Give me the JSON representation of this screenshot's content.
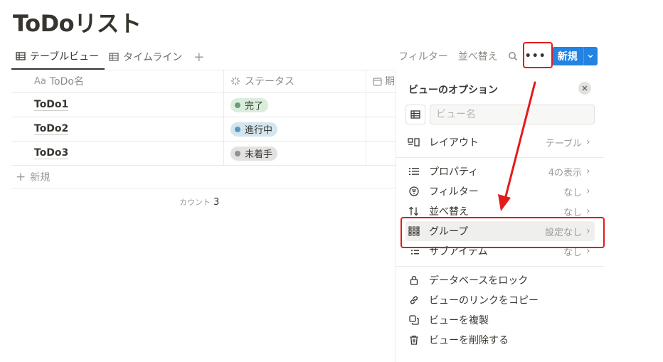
{
  "page": {
    "title": "ToDoリスト"
  },
  "views": {
    "tabs": [
      {
        "label": "テーブルビュー",
        "icon": "table-icon",
        "active": true
      },
      {
        "label": "タイムライン",
        "icon": "timeline-icon",
        "active": false
      }
    ],
    "add_symbol": "+"
  },
  "toolbar": {
    "filter": "フィルター",
    "sort": "並べ替え",
    "search_icon": "search-icon",
    "more": "•••",
    "new_label": "新規"
  },
  "table": {
    "columns": [
      {
        "prefix": "Aa",
        "label": "ToDo名"
      },
      {
        "label": "ステータス",
        "icon": "status-icon"
      },
      {
        "label": "期",
        "icon": "calendar-icon"
      }
    ],
    "rows": [
      {
        "name": "ToDo1",
        "status": "完了",
        "status_color": "#6c9b7d",
        "status_bg": "#dbeddb"
      },
      {
        "name": "ToDo2",
        "status": "進行中",
        "status_color": "#5b97bd",
        "status_bg": "#d3e5ef"
      },
      {
        "name": "ToDo3",
        "status": "未着手",
        "status_color": "#91918e",
        "status_bg": "#e3e2e0"
      }
    ],
    "new_row": "新規",
    "count_label": "カウント",
    "count_value": "3"
  },
  "options_panel": {
    "title": "ビューのオプション",
    "name_placeholder": "ビュー名",
    "layout": {
      "label": "レイアウト",
      "value": "テーブル"
    },
    "properties": {
      "label": "プロパティ",
      "value": "4の表示"
    },
    "filter": {
      "label": "フィルター",
      "value": "なし"
    },
    "sort": {
      "label": "並べ替え",
      "value": "なし"
    },
    "group": {
      "label": "グループ",
      "value": "設定なし"
    },
    "subitems": {
      "label": "サブアイテム",
      "value": "なし"
    },
    "lock": "データベースをロック",
    "copy_link": "ビューのリンクをコピー",
    "duplicate": "ビューを複製",
    "delete": "ビューを削除する",
    "chevron": "›"
  },
  "colors": {
    "accent": "#2383e2",
    "highlight": "#e31b1b"
  }
}
